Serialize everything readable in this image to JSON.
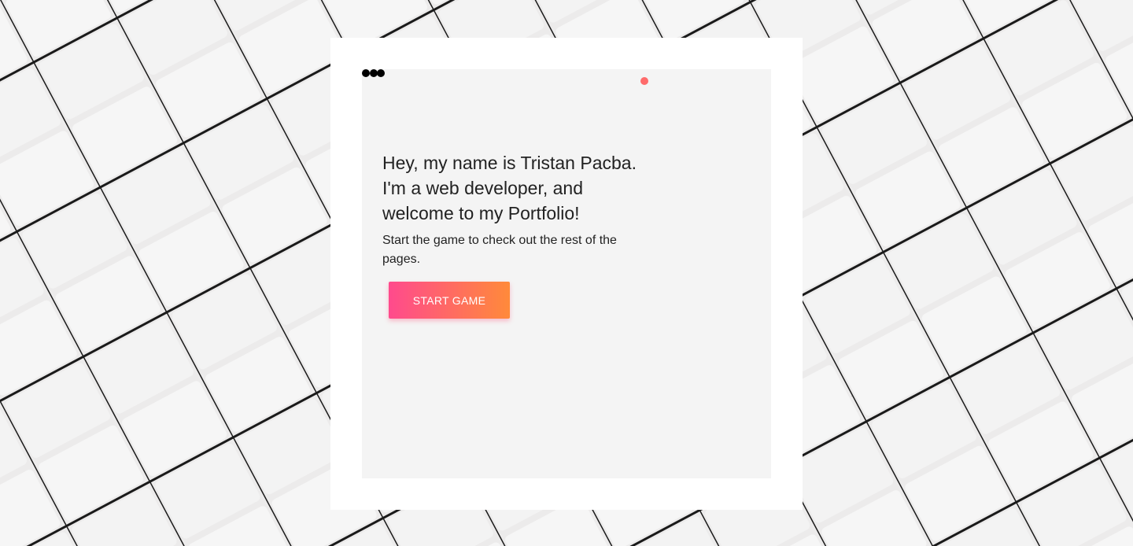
{
  "colors": {
    "page_background": "#eceaea",
    "frame": "#ffffff",
    "board": "#f4f4f4",
    "snake": "#000000",
    "food": "#ff6b6b",
    "button_gradient_start": "#ff4a8d",
    "button_gradient_end": "#ff8a3a",
    "button_text": "#ffffff",
    "text": "#222222"
  },
  "game": {
    "snake_segments": 3,
    "intro": {
      "headline_line1": "Hey, my name is Tristan Pacba.",
      "headline_line2": "I'm a web developer, and",
      "headline_line3": "welcome to my Portfolio!",
      "subline": "Start the game to check out the rest of the pages."
    },
    "start_button_label": "START GAME"
  }
}
